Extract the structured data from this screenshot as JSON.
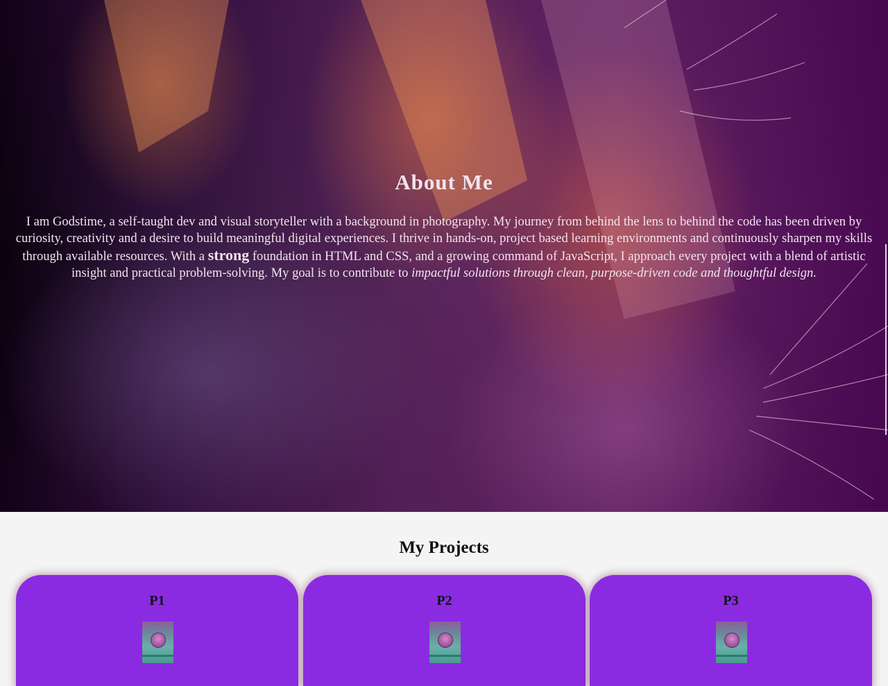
{
  "about": {
    "heading": "About Me",
    "paragraph_part1": "I am Godstime, a self-taught dev and visual storyteller with a background in photography. My journey from behind the lens to behind the code has been driven by curiosity, creativity and a desire to build meaningful digital experiences. I thrive in hands-on, project based learning environments and continuously sharpen my skills through available resources. With a ",
    "strong_word": "strong",
    "paragraph_part2": " foundation in HTML and CSS, and a growing command of JavaScript, I approach every project with a blend of artistic insight and practical problem-solving. My goal is to contribute to ",
    "emphasis": "impactful solutions through clean, purpose-driven code and thoughtful design."
  },
  "projects": {
    "heading": "My Projects",
    "cards": [
      {
        "title": "P1"
      },
      {
        "title": "P2"
      },
      {
        "title": "P3"
      }
    ]
  },
  "colors": {
    "card_background": "#8a2be2",
    "section_background": "#f4f4f4",
    "hero_text": "#f1e4ee"
  }
}
